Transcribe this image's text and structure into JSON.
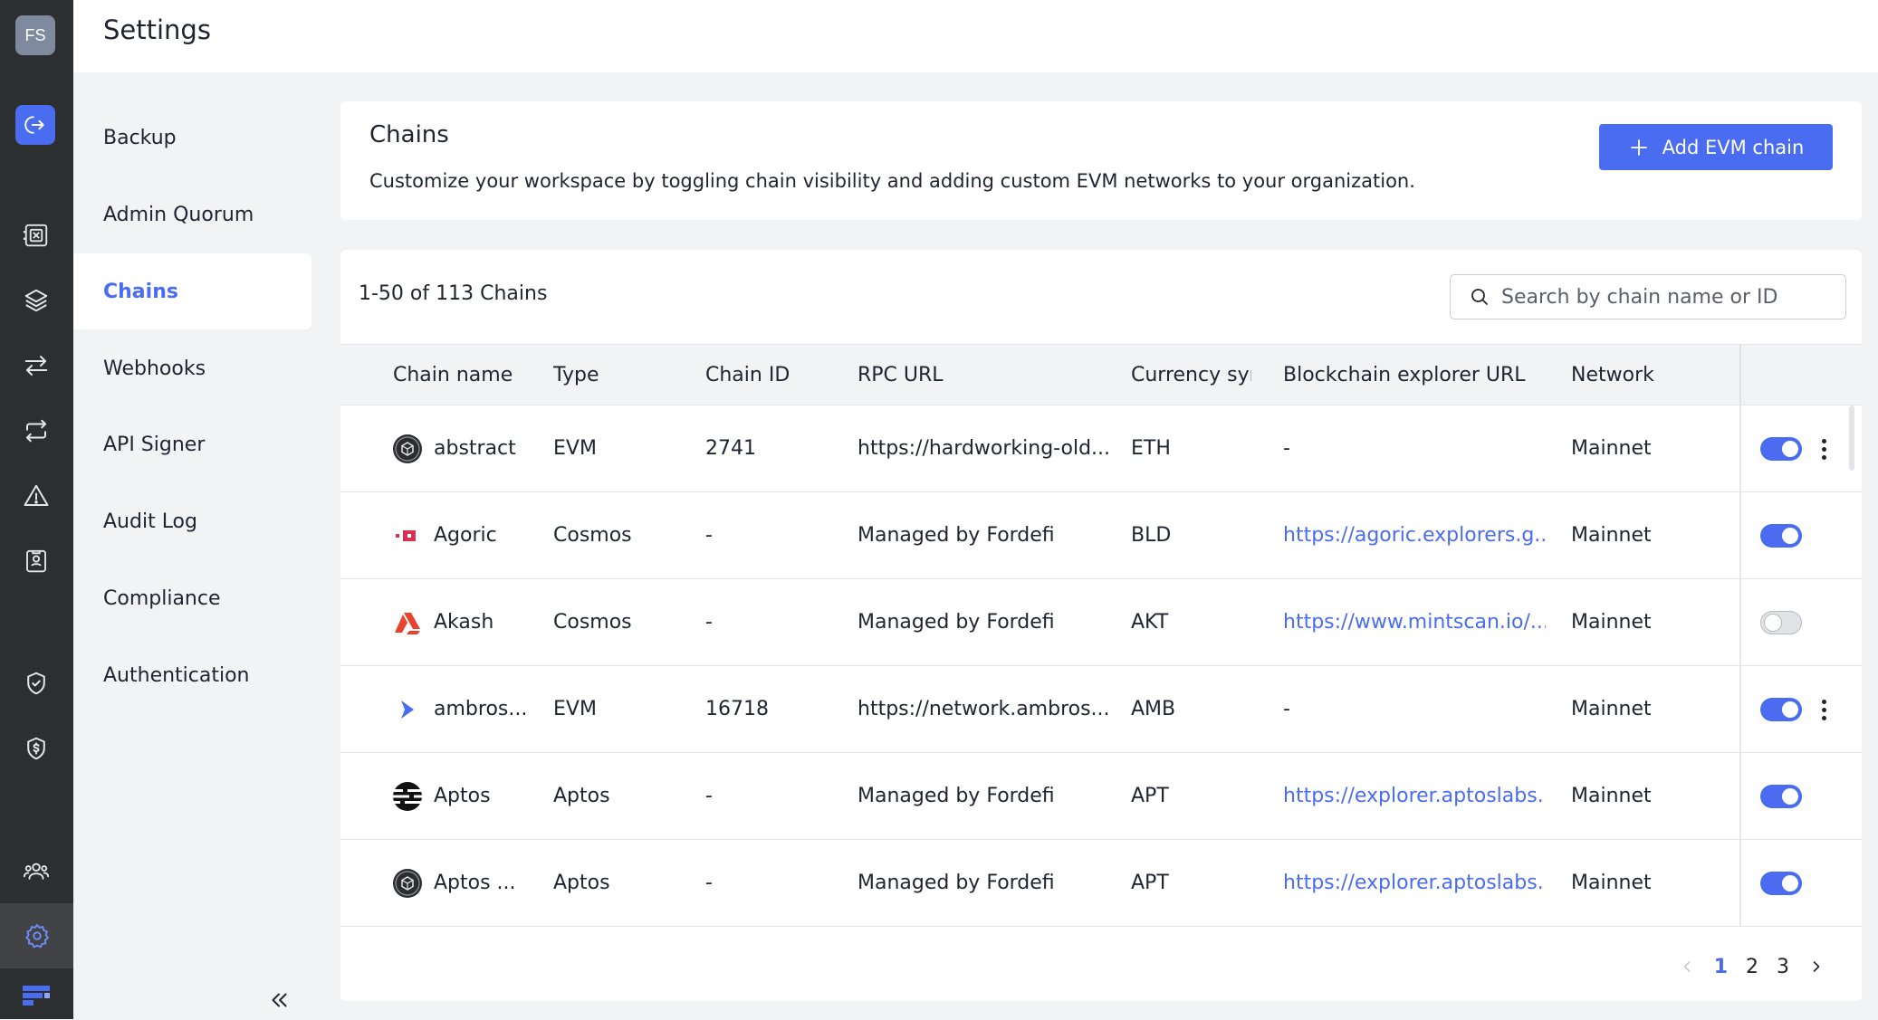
{
  "user": {
    "initials": "FS"
  },
  "page_title": "Settings",
  "settings_nav": [
    {
      "label": "Backup",
      "active": false
    },
    {
      "label": "Admin Quorum",
      "active": false
    },
    {
      "label": "Chains",
      "active": true
    },
    {
      "label": "Webhooks",
      "active": false
    },
    {
      "label": "API Signer",
      "active": false
    },
    {
      "label": "Audit Log",
      "active": false
    },
    {
      "label": "Compliance",
      "active": false
    },
    {
      "label": "Authentication",
      "active": false
    }
  ],
  "header_card": {
    "title": "Chains",
    "description": "Customize your workspace by toggling chain visibility and adding custom EVM networks to your organization.",
    "add_button_label": "Add EVM chain"
  },
  "table": {
    "count_label": "1-50 of 113 Chains",
    "search_placeholder": "Search by chain name or ID",
    "columns": [
      "Chain name",
      "Type",
      "Chain ID",
      "RPC URL",
      "Currency syı",
      "Blockchain explorer URL",
      "Network"
    ],
    "rows": [
      {
        "name": "abstract",
        "logo": "abstract-logo-icon",
        "type": "EVM",
        "chain_id": "2741",
        "rpc_url": "https://hardworking-old...",
        "currency": "ETH",
        "explorer": "-",
        "explorer_is_link": false,
        "network": "Mainnet",
        "enabled": true,
        "has_menu": true
      },
      {
        "name": "Agoric",
        "logo": "agoric-logo-icon",
        "type": "Cosmos",
        "chain_id": "-",
        "rpc_url": "Managed by Fordefi",
        "currency": "BLD",
        "explorer": "https://agoric.explorers.g...",
        "explorer_is_link": true,
        "network": "Mainnet",
        "enabled": true,
        "has_menu": false
      },
      {
        "name": "Akash",
        "logo": "akash-logo-icon",
        "type": "Cosmos",
        "chain_id": "-",
        "rpc_url": "Managed by Fordefi",
        "currency": "AKT",
        "explorer": "https://www.mintscan.io/...",
        "explorer_is_link": true,
        "network": "Mainnet",
        "enabled": false,
        "has_menu": false
      },
      {
        "name": "ambros...",
        "logo": "ambrosus-logo-icon",
        "type": "EVM",
        "chain_id": "16718",
        "rpc_url": "https://network.ambros...",
        "currency": "AMB",
        "explorer": "-",
        "explorer_is_link": false,
        "network": "Mainnet",
        "enabled": true,
        "has_menu": true
      },
      {
        "name": "Aptos",
        "logo": "aptos-logo-icon",
        "type": "Aptos",
        "chain_id": "-",
        "rpc_url": "Managed by Fordefi",
        "currency": "APT",
        "explorer": "https://explorer.aptoslabs...",
        "explorer_is_link": true,
        "network": "Mainnet",
        "enabled": true,
        "has_menu": false
      },
      {
        "name": "Aptos ...",
        "logo": "aptos-testnet-logo-icon",
        "type": "Aptos",
        "chain_id": "-",
        "rpc_url": "Managed by Fordefi",
        "currency": "APT",
        "explorer": "https://explorer.aptoslabs...",
        "explorer_is_link": true,
        "network": "Mainnet",
        "enabled": true,
        "has_menu": false
      }
    ]
  },
  "pagination": {
    "pages": [
      "1",
      "2",
      "3"
    ],
    "current": "1"
  },
  "colors": {
    "accent": "#4a6cf0",
    "rail_bg": "#2d2e30",
    "page_bg": "#f2f3f5",
    "link": "#4a6cf0"
  }
}
